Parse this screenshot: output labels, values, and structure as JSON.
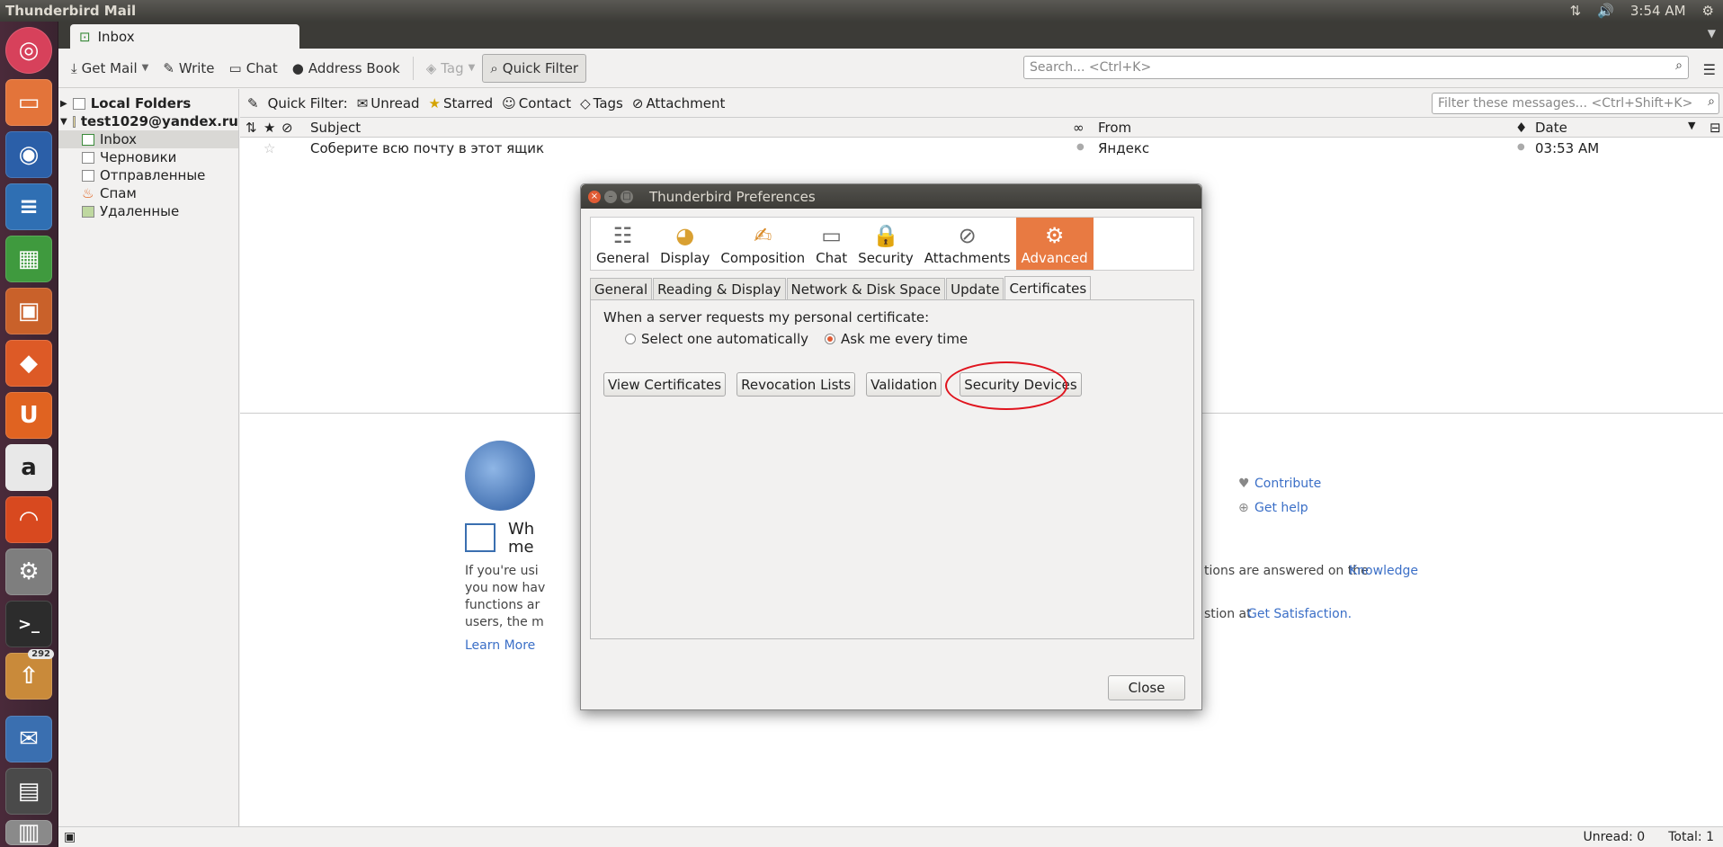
{
  "top_panel": {
    "title": "Thunderbird Mail",
    "time": "3:54 AM"
  },
  "launcher": {
    "badge_count": "292"
  },
  "tabs": [
    {
      "label": "Inbox"
    }
  ],
  "toolbar": {
    "get_mail": "Get Mail",
    "write": "Write",
    "chat": "Chat",
    "address_book": "Address Book",
    "tag": "Tag",
    "quick_filter": "Quick Filter",
    "search_placeholder": "Search... <Ctrl+K>"
  },
  "folders": [
    {
      "label": "Local Folders",
      "bold": true
    },
    {
      "label": "test1029@yandex.ru",
      "bold": true
    },
    {
      "label": "Inbox",
      "selected": true
    },
    {
      "label": "Черновики"
    },
    {
      "label": "Отправленные"
    },
    {
      "label": "Спам"
    },
    {
      "label": "Удаленные"
    }
  ],
  "quick_filter_bar": {
    "label": "Quick Filter:",
    "unread": "Unread",
    "starred": "Starred",
    "contact": "Contact",
    "tags": "Tags",
    "attachment": "Attachment",
    "filter_placeholder": "Filter these messages... <Ctrl+Shift+K>"
  },
  "columns": {
    "subject": "Subject",
    "from": "From",
    "date": "Date"
  },
  "messages": [
    {
      "subject": "Соберите всю почту в этот ящик",
      "from": "Яндекс",
      "date": "03:53 AM"
    }
  ],
  "start_page": {
    "contribute": "Contribute",
    "get_help": "Get help",
    "heading_fragment_1": "Wh",
    "heading_fragment_2": "me",
    "para_fragment_1": "If you're usi",
    "para_fragment_2": "you now hav",
    "para_fragment_3": "functions ar",
    "para_fragment_4": "users, the m",
    "learn_more": "Learn More",
    "knowledge_fragment": "tions are answered on the",
    "knowledge_link": "Knowledge",
    "satisfaction_fragment": "stion at",
    "satisfaction_link": "Get Satisfaction."
  },
  "status": {
    "unread": "Unread: 0",
    "total": "Total: 1"
  },
  "dialog": {
    "title": "Thunderbird Preferences",
    "panes": [
      "General",
      "Display",
      "Composition",
      "Chat",
      "Security",
      "Attachments",
      "Advanced"
    ],
    "active_pane": "Advanced",
    "subtabs": [
      "General",
      "Reading & Display",
      "Network & Disk Space",
      "Update",
      "Certificates"
    ],
    "active_subtab": "Certificates",
    "cert_label": "When a server requests my personal certificate:",
    "radio_auto": "Select one automatically",
    "radio_ask": "Ask me every time",
    "buttons": {
      "view_certificates": "View Certificates",
      "revocation_lists": "Revocation Lists",
      "validation": "Validation",
      "security_devices": "Security Devices"
    },
    "close": "Close"
  },
  "colors": {
    "accent": "#e87a42",
    "annotation": "#e0141e",
    "link": "#3b6fc7"
  }
}
